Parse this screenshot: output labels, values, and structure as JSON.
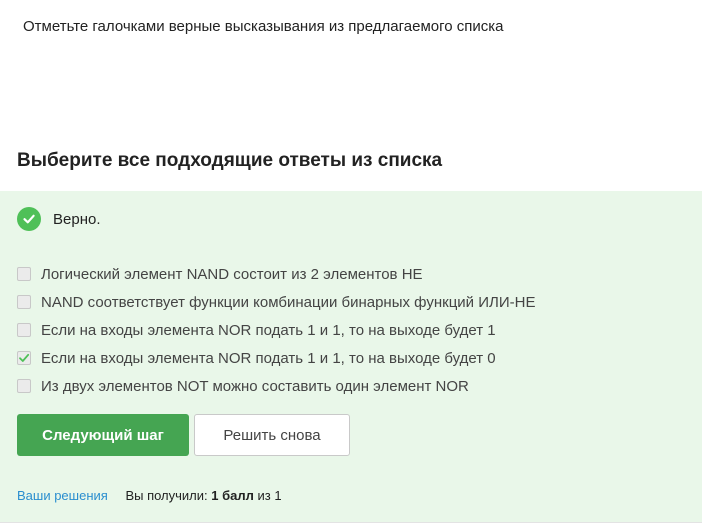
{
  "question": {
    "text": "Отметьте галочками верные высказывания из предлагаемого списка"
  },
  "section_title": "Выберите все подходящие ответы из списка",
  "feedback": {
    "status_icon": "check-circle-icon",
    "text": "Верно."
  },
  "options": [
    {
      "label": "Логический элемент NAND состоит из 2 элементов НЕ",
      "checked": false
    },
    {
      "label": "NAND соответствует функции комбинации бинарных функций ИЛИ-НЕ",
      "checked": false
    },
    {
      "label": "Если на входы элемента NOR подать 1 и 1, то на выходе будет 1",
      "checked": false
    },
    {
      "label": "Если на входы элемента NOR подать 1 и 1, то на выходе будет 0",
      "checked": true
    },
    {
      "label": "Из двух элементов NOT можно составить один элемент NOR",
      "checked": false
    }
  ],
  "buttons": {
    "next_label": "Следующий шаг",
    "retry_label": "Решить снова"
  },
  "footer": {
    "solutions_link": "Ваши решения",
    "score_prefix": "Вы получили: ",
    "score_value": "1 балл",
    "score_suffix": " из 1"
  },
  "colors": {
    "panel_background": "#e9f7e9",
    "success_green": "#4fc058",
    "primary_button": "#45a552",
    "link_blue": "#2a8ecf"
  }
}
